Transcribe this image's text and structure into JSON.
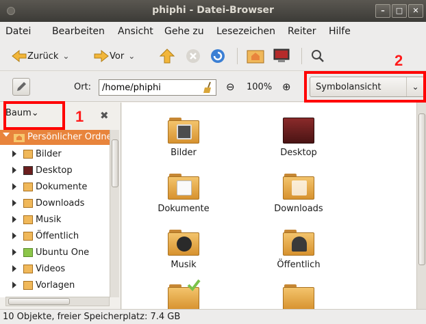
{
  "window": {
    "title": "phiphi - Datei-Browser"
  },
  "menu": [
    "Datei",
    "Bearbeiten",
    "Ansicht",
    "Gehe zu",
    "Lesezeichen",
    "Reiter",
    "Hilfe"
  ],
  "toolbar": {
    "back_label": "Zurück",
    "forward_label": "Vor"
  },
  "location": {
    "label": "Ort:",
    "path": "/home/phiphi",
    "zoom": "100%"
  },
  "view_mode": {
    "selected": "Symbolansicht"
  },
  "sidebar": {
    "mode_label": "Baum",
    "root_label": "Persönlicher Ordner",
    "items": [
      "Bilder",
      "Desktop",
      "Dokumente",
      "Downloads",
      "Musik",
      "Öffentlich",
      "Ubuntu One",
      "Videos",
      "Vorlagen"
    ]
  },
  "files": [
    "Bilder",
    "Desktop",
    "Dokumente",
    "Downloads",
    "Musik",
    "Öffentlich",
    "",
    ""
  ],
  "status": {
    "text": "10 Objekte, freier Speicherplatz: 7.4 GB"
  },
  "annotations": [
    "1",
    "2"
  ],
  "colors": {
    "accent": "#e8843c",
    "annotation": "#ff0000",
    "folder": "#f3c46c"
  }
}
